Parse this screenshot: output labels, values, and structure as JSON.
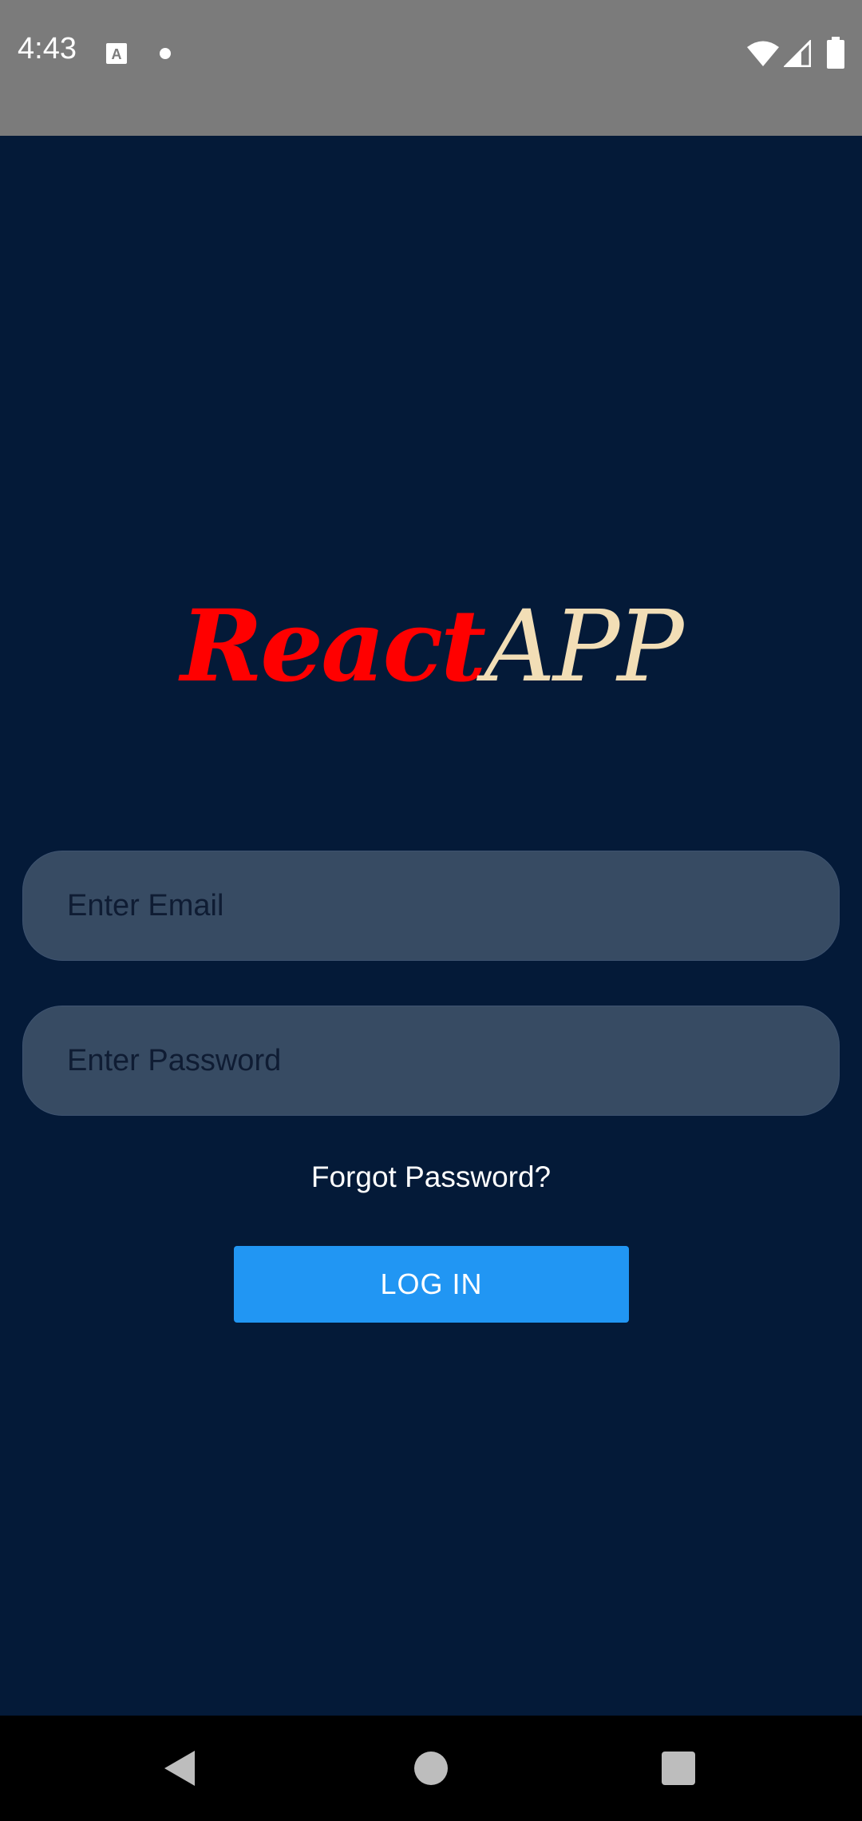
{
  "status_bar": {
    "time": "4:43",
    "icons": [
      "keyboard-a-icon",
      "notification-dot-icon",
      "wifi-icon",
      "cell-signal-icon",
      "battery-icon"
    ]
  },
  "logo": {
    "part1": "React",
    "part2": "APP",
    "part1_color": "#ff0000",
    "part2_color": "#f2deb6"
  },
  "form": {
    "email_placeholder": "Enter Email",
    "password_placeholder": "Enter Password",
    "email_value": "",
    "password_value": ""
  },
  "forgot_password": "Forgot Password?",
  "login_button": "LOG IN",
  "colors": {
    "background": "#041a38",
    "field": "#374b63",
    "button": "#2196f3",
    "status_bar": "#7b7b7b"
  },
  "nav_bar": {
    "icons": [
      "back-icon",
      "home-icon",
      "recents-icon"
    ]
  }
}
